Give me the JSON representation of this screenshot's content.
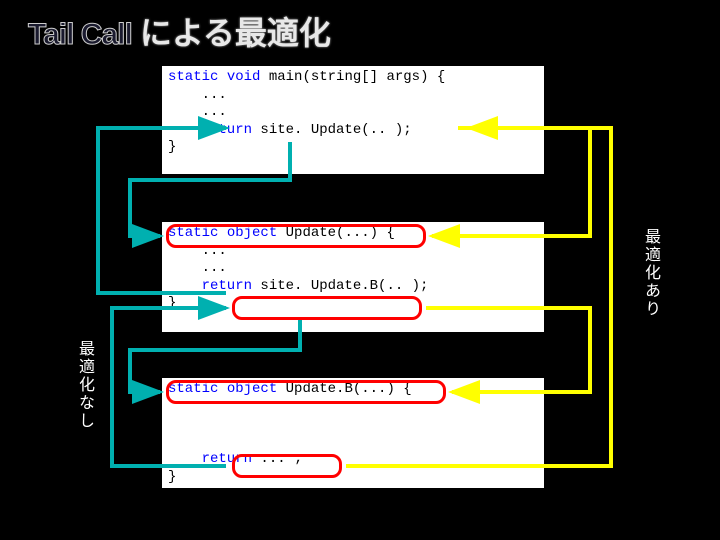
{
  "title": {
    "en": "Tail Call",
    "jp": "による最適化"
  },
  "code": {
    "block1": {
      "sig_pre": "static",
      "sig_mid": " void",
      "sig_post": " main(string[] args) {",
      "body1": "    ...",
      "body2": "    ...",
      "ret_kw": "    return",
      "ret_rest": " site. Update(.. );",
      "close": "}"
    },
    "block2": {
      "sig_pre": "static",
      "sig_mid": " object",
      "sig_post": " Update(...) {",
      "body1": "    ...",
      "body2": "    ...",
      "ret_kw": "    return",
      "ret_rest": " site. Update.B(.. );",
      "close": "}"
    },
    "block3": {
      "sig_pre": "static",
      "sig_mid": " object",
      "sig_post": " Update.B(...) {",
      "blank": "",
      "ret_kw": "    return",
      "ret_rest": " ... ;",
      "close": "}"
    }
  },
  "labels": {
    "left": "最適化なし",
    "right": "最適化あり"
  }
}
